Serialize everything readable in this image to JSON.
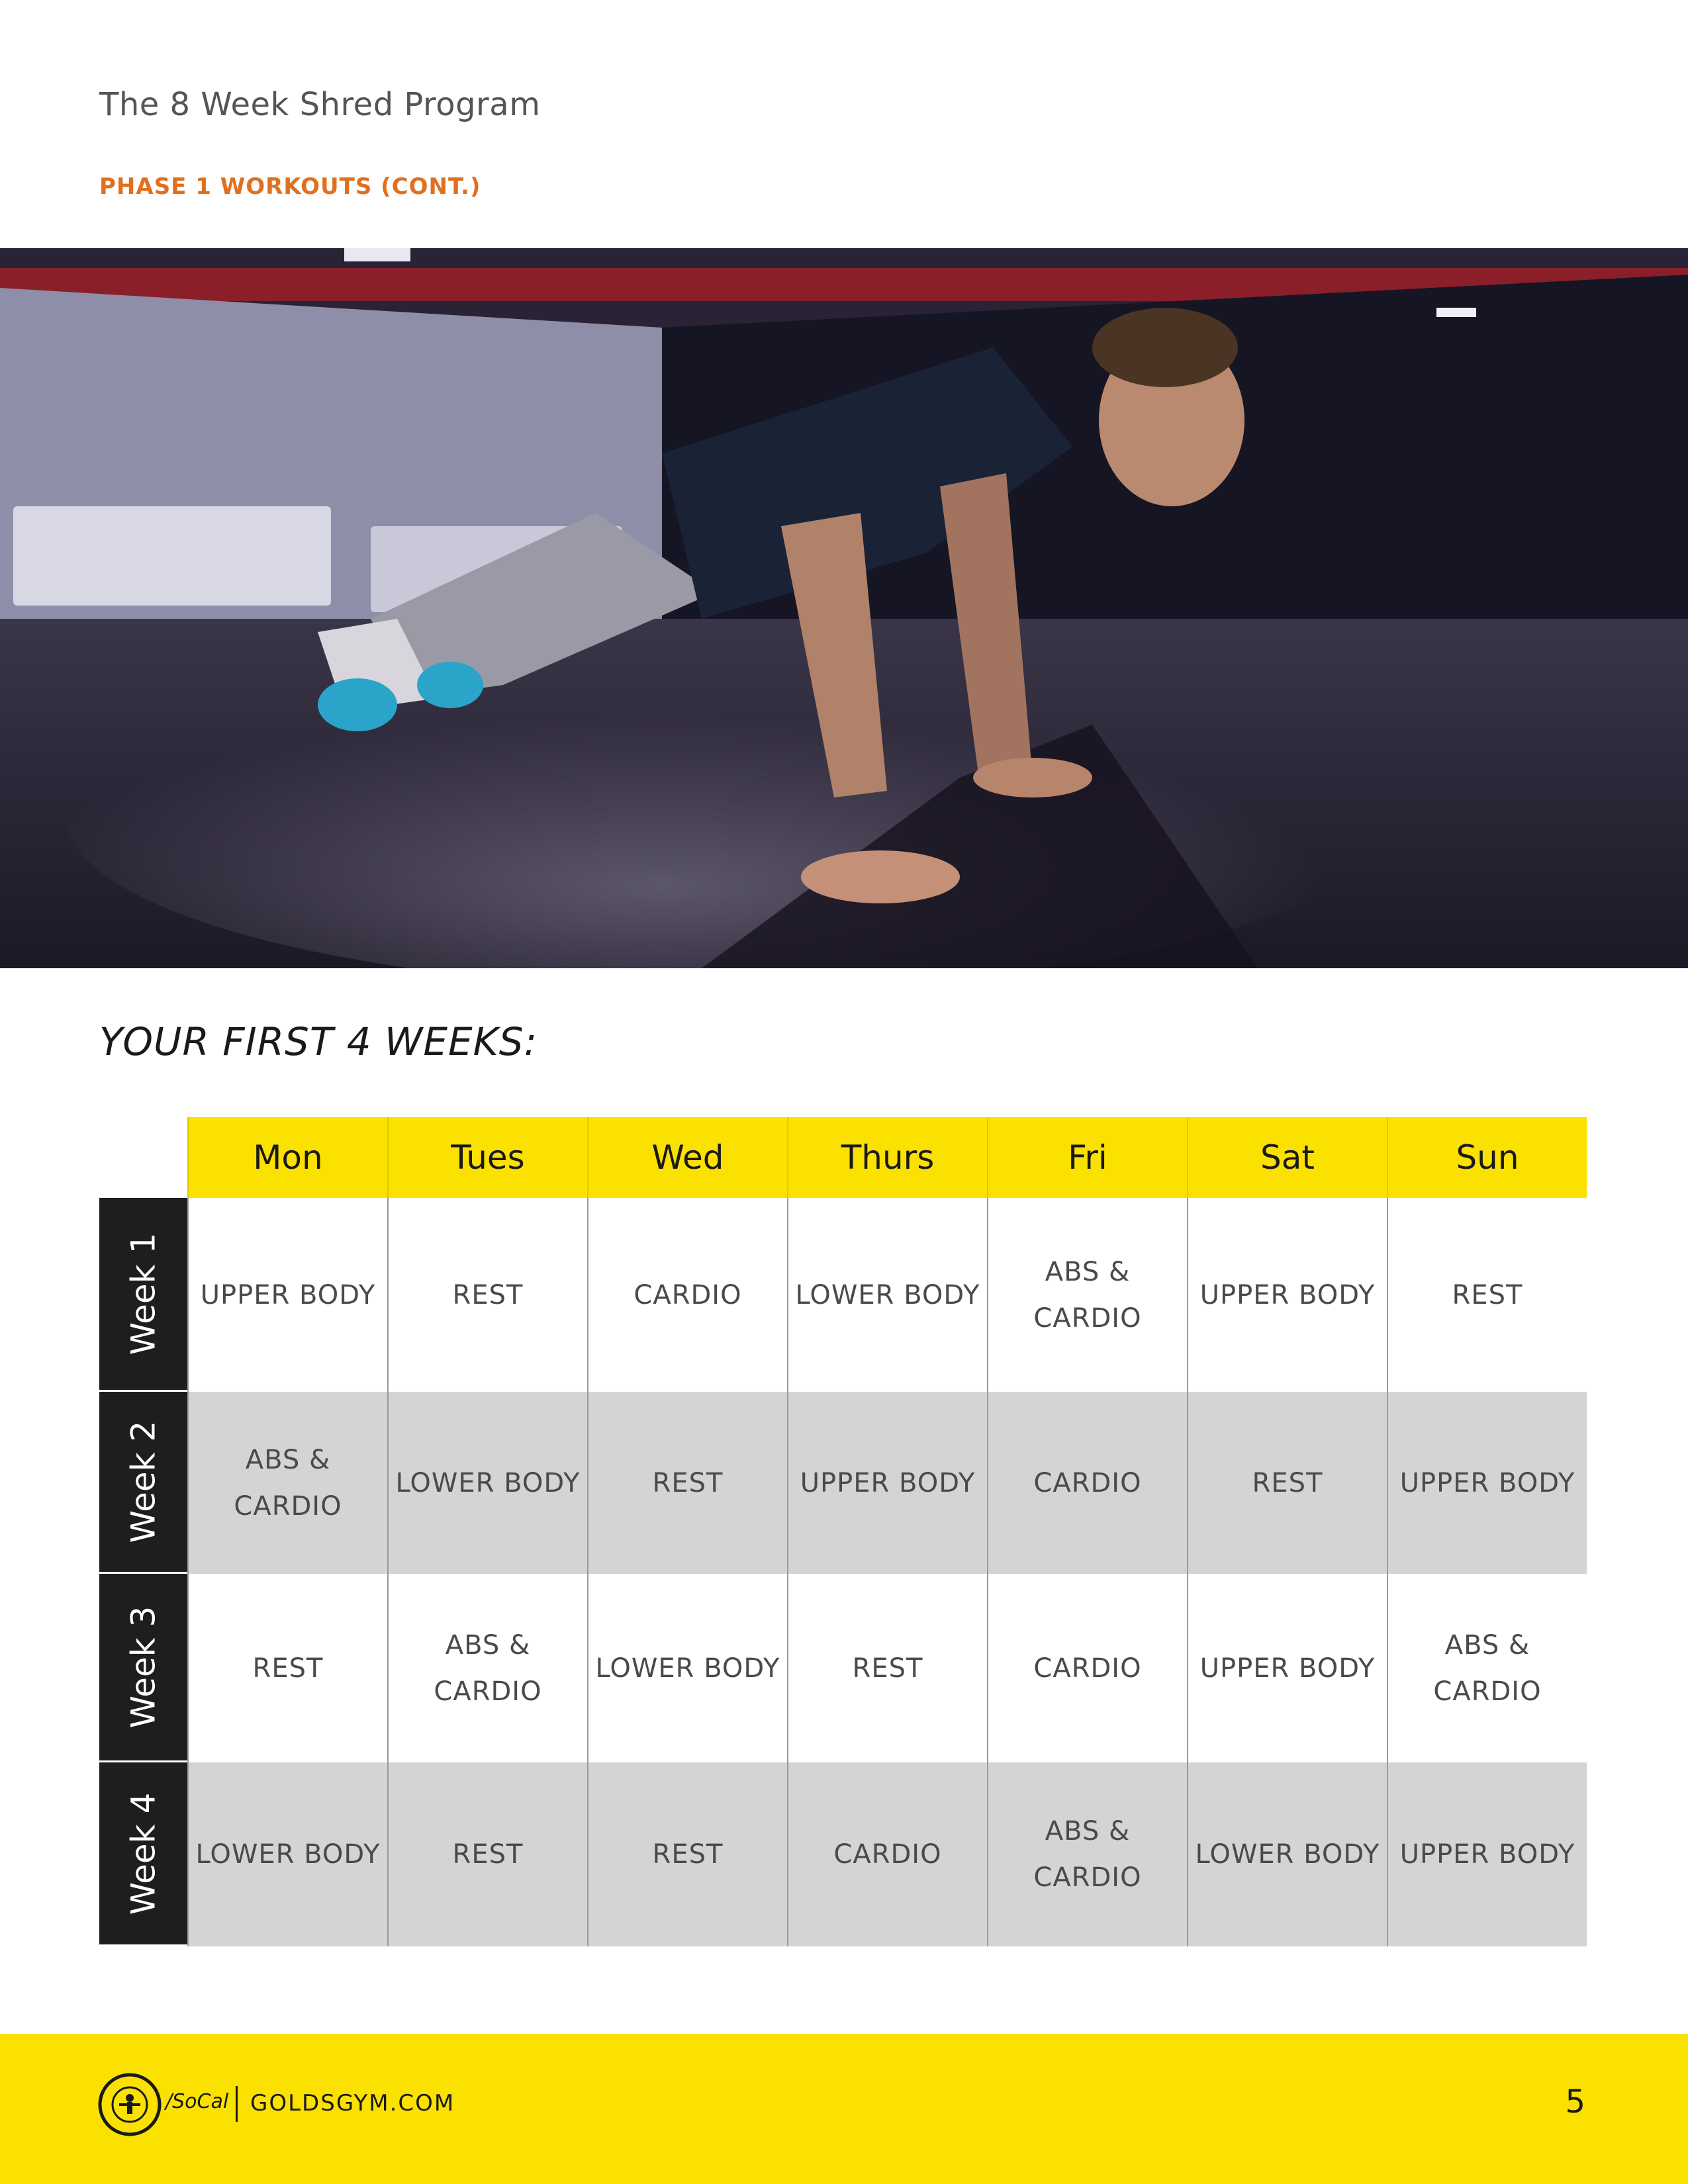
{
  "header": {
    "doc_title": "The 8 Week Shred Program",
    "section_label": "PHASE 1 WORKOUTS (CONT.)"
  },
  "hero": {
    "description": "man doing push-up plank in gym"
  },
  "schedule": {
    "heading": "YOUR FIRST 4 WEEKS:",
    "days": [
      "Mon",
      "Tues",
      "Wed",
      "Thurs",
      "Fri",
      "Sat",
      "Sun"
    ],
    "weeks": [
      {
        "label": "Week 1",
        "cells": [
          "UPPER BODY",
          "REST",
          "CARDIO",
          "LOWER BODY",
          "ABS & CARDIO",
          "UPPER BODY",
          "REST"
        ]
      },
      {
        "label": "Week 2",
        "cells": [
          "ABS & CARDIO",
          "LOWER BODY",
          "REST",
          "UPPER BODY",
          "CARDIO",
          "REST",
          "UPPER BODY"
        ]
      },
      {
        "label": "Week 3",
        "cells": [
          "REST",
          "ABS & CARDIO",
          "LOWER BODY",
          "REST",
          "CARDIO",
          "UPPER BODY",
          "ABS & CARDIO"
        ]
      },
      {
        "label": "Week 4",
        "cells": [
          "LOWER BODY",
          "REST",
          "REST",
          "CARDIO",
          "ABS & CARDIO",
          "LOWER BODY",
          "UPPER BODY"
        ]
      }
    ]
  },
  "footer": {
    "logo_text": "GOLD'S GYM",
    "logo_suffix": "/SoCal",
    "website": "GOLDSGYM.COM",
    "page_number": "5"
  },
  "colors": {
    "accent_yellow": "#fbe100",
    "section_orange": "#e07020",
    "week_label_bg": "#1e1e1e",
    "row_grey": "#d4d4d4"
  }
}
